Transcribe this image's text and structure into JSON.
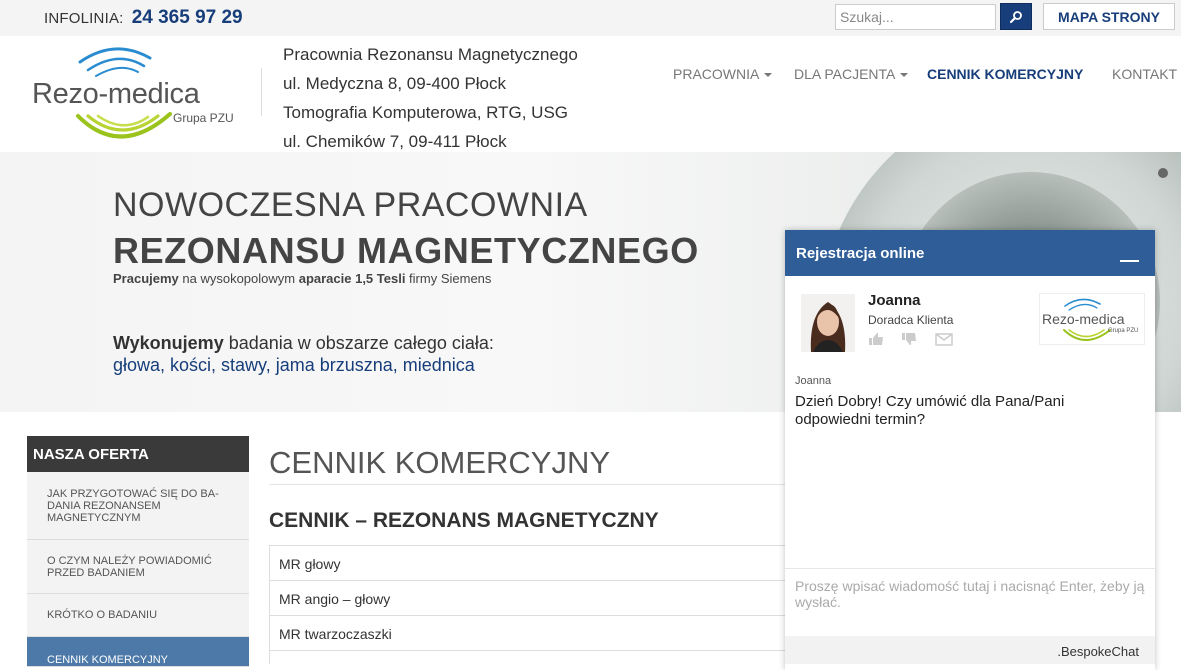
{
  "topbar": {
    "infolinia_label": "INFOLINIA:",
    "infolinia_number": "24 365 97 29",
    "search_placeholder": "Szukaj...",
    "search_icon": "magnifier-icon",
    "sitemap_label": "MAPA STRONY"
  },
  "header": {
    "logo_text": "Rezo-medica",
    "logo_subtext": "Grupa PZU",
    "address": [
      "Pracownia Rezonansu Magnetycznego",
      "ul. Medyczna 8, 09-400 Płock",
      "Tomografia Komputerowa, RTG, USG",
      "ul. Chemików 7, 09-411 Płock"
    ],
    "nav": [
      {
        "label": "PRACOWNIA",
        "dropdown": true
      },
      {
        "label": "DLA PACJENTA",
        "dropdown": true
      },
      {
        "label": "CENNIK KOMERCYJNY",
        "active": true
      },
      {
        "label": "KONTAKT"
      }
    ]
  },
  "hero": {
    "line1": "NOWOCZESNA PRACOWNIA",
    "line2": "REZONANSU MAGNETYCZNEGO",
    "sub_bold1": "Pracujemy",
    "sub_text1": " na wysokopolowym ",
    "sub_bold2": "aparacie 1,5 Tesli",
    "sub_text2": " firmy Siemens",
    "wyk_bold": "Wykonujemy",
    "wyk_text": " badania w obszarze całego ciała:",
    "body_parts": "głowa, kości, stawy, jama brzuszna, miednica"
  },
  "sidebar": {
    "title": "NASZA OFERTA",
    "items": [
      {
        "label": "JAK PRZYGOTOWAĆ SIĘ DO BA-DANIA REZONANSEM MAGNETYCZNYM"
      },
      {
        "label": "O CZYM NALEŻY POWIADOMIĆ PRZED BADANIEM"
      },
      {
        "label": "KRÓTKO O BADANIU"
      },
      {
        "label": "CENNIK KOMERCYJNY",
        "active": true
      }
    ]
  },
  "content": {
    "title": "CENNIK KOMERCYJNY",
    "subtitle": "CENNIK – REZONANS MAGNETYCZNY",
    "rows": [
      "MR głowy",
      "MR angio – głowy",
      "MR twarzoczaszki"
    ]
  },
  "chat": {
    "header": "Rejestracja online",
    "agent_name": "Joanna",
    "agent_role": "Doradca Klienta",
    "logo_text": "Rezo-medica",
    "logo_subtext": "Grupa PZU",
    "message_sender": "Joanna",
    "message_text": "Dzień Dobry! Czy umówić dla Pana/Pani odpowiedni termin?",
    "input_placeholder": "Proszę wpisać wiadomość tutaj i nacisnąć Enter, żeby ją wysłać.",
    "footer": ".BespokeChat"
  },
  "colors": {
    "brand_blue": "#173e7a",
    "chat_header": "#2f5d97",
    "sidebar_active": "#4c79a8",
    "sidebar_title": "#3a3a3a",
    "logo_green": "#9ac31c",
    "logo_blue": "#2a8cd0"
  }
}
